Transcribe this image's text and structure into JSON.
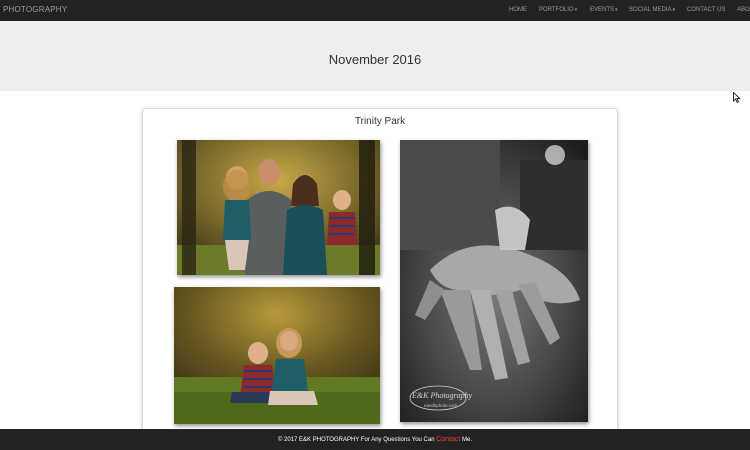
{
  "navbar": {
    "brand": "PHOTOGRAPHY",
    "items": [
      {
        "label": "HOME",
        "dropdown": false
      },
      {
        "label": "PORTFOLIO",
        "dropdown": true
      },
      {
        "label": "EVENTS",
        "dropdown": true
      },
      {
        "label": "SOCIAL MEDIA",
        "dropdown": true
      },
      {
        "label": "CONTACT US",
        "dropdown": false
      },
      {
        "label": "ABO",
        "dropdown": false
      }
    ],
    "caret_glyph": "▾"
  },
  "header": {
    "title": "November 2016"
  },
  "gallery": {
    "title": "Trinity Park",
    "photos": [
      {
        "name": "family-portrait-photo",
        "subject": "family of four in autumn park"
      },
      {
        "name": "hands-bw-photo",
        "subject": "black and white stacked family hands",
        "watermark": {
          "logo": "E&K Photography",
          "url": "eandkphoto.com"
        }
      },
      {
        "name": "children-on-grass-photo",
        "subject": "two children sitting on grass"
      }
    ]
  },
  "footer": {
    "prefix": "© 2017 E&K PHOTOGRAPHY For Any Questions You Can ",
    "link": "Contact",
    "suffix": " Me."
  },
  "colors": {
    "navbar_bg": "#222222",
    "nav_text": "#9d9d9d",
    "header_bg": "#eeeeee",
    "footer_link": "#e8452c"
  }
}
